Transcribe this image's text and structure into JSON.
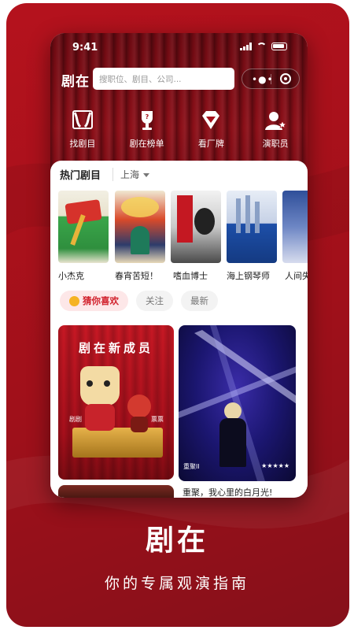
{
  "status_bar": {
    "time": "9:41"
  },
  "nav": {
    "logo": "剧在",
    "search_placeholder": "搜职位、剧目、公司..."
  },
  "quick_links": [
    {
      "label": "找剧目",
      "icon": "curtain-icon"
    },
    {
      "label": "剧在榜单",
      "icon": "trophy-icon"
    },
    {
      "label": "看厂牌",
      "icon": "diamond-icon"
    },
    {
      "label": "演职员",
      "icon": "actor-icon"
    }
  ],
  "hot": {
    "heading": "热门剧目",
    "city": "上海"
  },
  "shows": [
    {
      "title": "小杰克"
    },
    {
      "title": "春宵苦短！"
    },
    {
      "title": "嗜血博士"
    },
    {
      "title": "海上钢琴师"
    },
    {
      "title": "人间失"
    }
  ],
  "filters": [
    {
      "label": "猜你喜欢",
      "active": true
    },
    {
      "label": "关注",
      "active": false
    },
    {
      "label": "最新",
      "active": false
    }
  ],
  "feed": {
    "card1": {
      "title": "剧在新成员",
      "left_label": "剧剧",
      "right_label": "票票"
    },
    "card2": {
      "watermark": "重聚II",
      "stars": "★★★★★",
      "caption": "重聚，我心里的白月光!"
    }
  },
  "promo": {
    "title": "剧在",
    "subtitle": "你的专属观演指南"
  },
  "colors": {
    "brand_red": "#b5121d",
    "chip_active": "#d11f2a"
  }
}
